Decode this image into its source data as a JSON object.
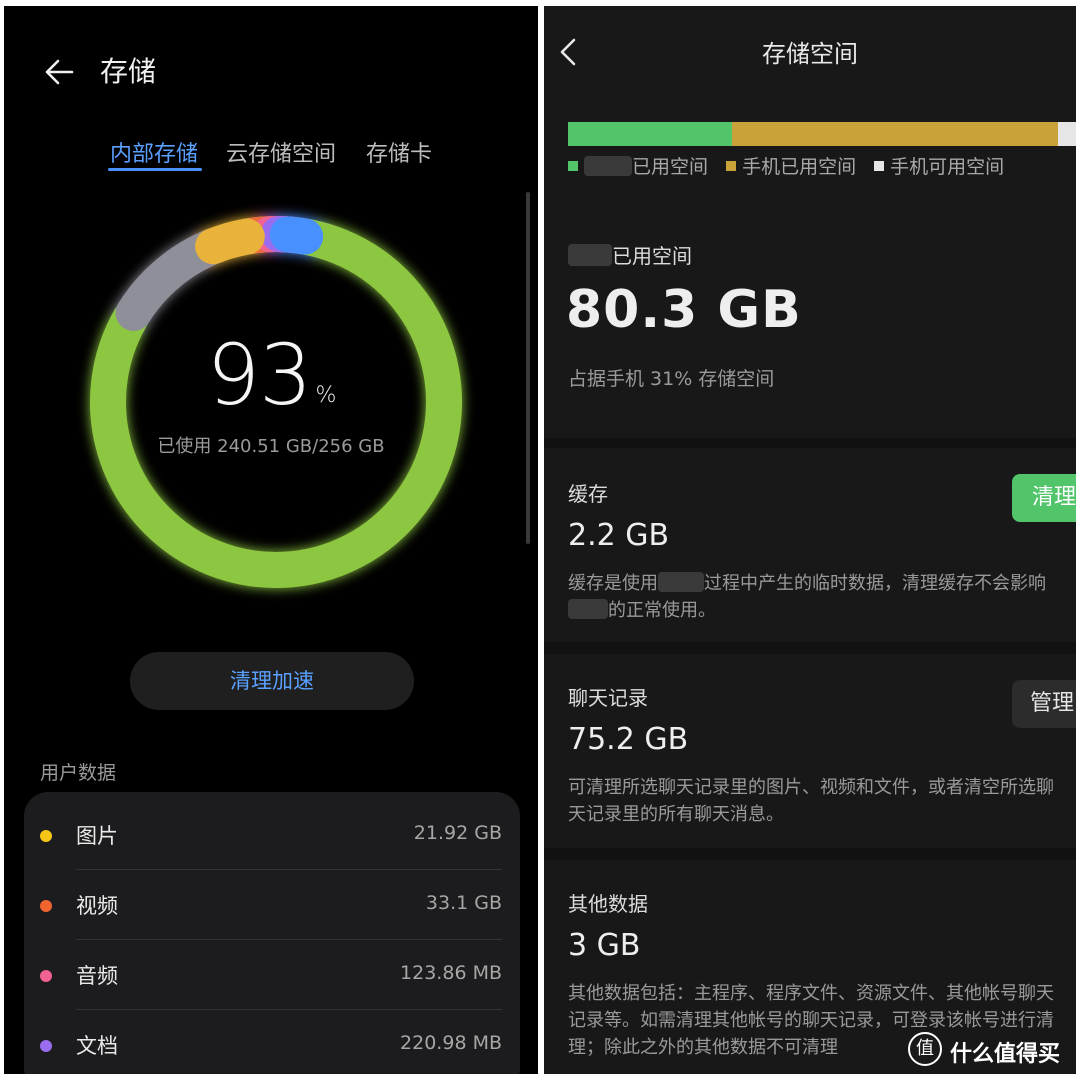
{
  "left": {
    "title": "存储",
    "tabs": [
      "内部存储",
      "云存储空间",
      "存储卡"
    ],
    "active_tab": 0,
    "ring": {
      "percent": "93",
      "percent_sign": "%",
      "used_text": "已使用 240.51 GB/256 GB",
      "fraction_used": 0.93,
      "colors": {
        "green": "#8dc63f",
        "gray": "#8f8f9a",
        "yellow": "#e8b23a",
        "orange": "#ee6b3a",
        "pink": "#f06292",
        "purple": "#9a6cf0",
        "blue": "#4a90ff"
      }
    },
    "clean_button": "清理加速",
    "section_title": "用户数据",
    "items": [
      {
        "name": "图片",
        "size": "21.92 GB",
        "color": "#f5c518"
      },
      {
        "name": "视频",
        "size": "33.1 GB",
        "color": "#f06430"
      },
      {
        "name": "音频",
        "size": "123.86 MB",
        "color": "#f06292"
      },
      {
        "name": "文档",
        "size": "220.98 MB",
        "color": "#9a6cf0"
      }
    ]
  },
  "right": {
    "title": "存储空间",
    "legend": [
      "已用空间",
      "手机已用空间",
      "手机可用空间"
    ],
    "legend_colors": [
      "#52c46a",
      "#c9a23a",
      "#e6e6e6"
    ],
    "used_label": "已用空间",
    "used_value": "80.3 GB",
    "used_desc": "占据手机 31% 存储空间",
    "cache": {
      "label": "缓存",
      "value": "2.2 GB",
      "button": "清理",
      "desc_a": "缓存是使用",
      "desc_b": "过程中产生的临时数据，清理缓存不会影响",
      "desc_c": "的正常使用。"
    },
    "chat": {
      "label": "聊天记录",
      "value": "75.2 GB",
      "button": "管理",
      "desc": "可清理所选聊天记录里的图片、视频和文件，或者清空所选聊天记录里的所有聊天消息。"
    },
    "other": {
      "label": "其他数据",
      "value": "3 GB",
      "desc": "其他数据包括：主程序、程序文件、资源文件、其他帐号聊天记录等。如需清理其他帐号的聊天记录，可登录该帐号进行清理；除此之外的其他数据不可清理"
    }
  },
  "watermark": {
    "logo": "值",
    "text": "什么值得买"
  }
}
